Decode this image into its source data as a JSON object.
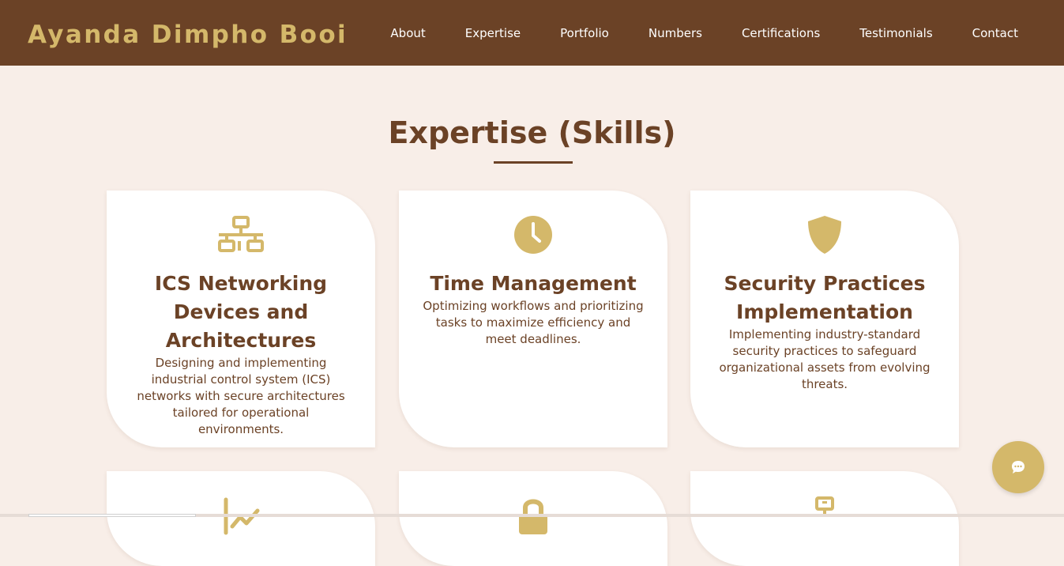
{
  "header": {
    "brand": "Ayanda Dimpho Booi",
    "nav": [
      "About",
      "Expertise",
      "Portfolio",
      "Numbers",
      "Certifications",
      "Testimonials",
      "Contact"
    ]
  },
  "expertise": {
    "title": "Expertise (Skills)",
    "cards": [
      {
        "icon": "network-icon",
        "title": "ICS Networking Devices and Architectures",
        "description": "Designing and implementing industrial control system (ICS) networks with secure architectures tailored for operational environments."
      },
      {
        "icon": "clock-icon",
        "title": "Time Management",
        "description": "Optimizing workflows and prioritizing tasks to maximize efficiency and meet deadlines."
      },
      {
        "icon": "shield-icon",
        "title": "Security Practices Implementation",
        "description": "Implementing industry-standard security practices to safeguard organizational assets from evolving threats."
      },
      {
        "icon": "chart-line-icon",
        "title": "",
        "description": ""
      },
      {
        "icon": "lock-icon",
        "title": "",
        "description": ""
      },
      {
        "icon": "server-icon",
        "title": "",
        "description": ""
      }
    ]
  },
  "chat": {
    "icon": "chat-icon"
  },
  "colors": {
    "header_bg": "#6b4226",
    "brand": "#d4b86a",
    "page_bg": "#f8eee8",
    "accent": "#d4b86a",
    "text": "#6b4226"
  }
}
